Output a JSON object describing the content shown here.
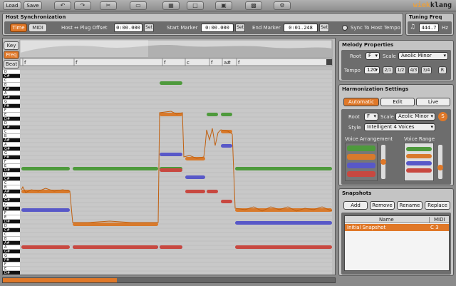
{
  "toolbar": {
    "load": "Load",
    "save": "Save",
    "icons": [
      "undo-icon",
      "redo-icon",
      "cut-icon",
      "copy-icon",
      "paste-icon",
      "delete-icon",
      "quantize-icon",
      "align-icon",
      "settings-icon"
    ]
  },
  "brand": {
    "part1": "wiek",
    "part2": "klang"
  },
  "host_sync": {
    "title": "Host Synchronization",
    "time": "Time",
    "midi": "MIDI",
    "offset_label": "Host ↔ Plug Offset",
    "offset_value": "0:00.000",
    "set": "Set",
    "start_label": "Start Marker",
    "start_value": "0:00.000",
    "end_label": "End Marker",
    "end_value": "0:01.248",
    "sync_label": "Sync To Host Tempo"
  },
  "tuning": {
    "title": "Tuning Freq",
    "value": "444.7",
    "unit": "Hz"
  },
  "editor": {
    "modes": [
      "Key",
      "Freq",
      "Beat"
    ],
    "active_mode": "Freq",
    "chord_markers": [
      "f",
      "f",
      "f",
      "c",
      "f",
      "a#",
      "f"
    ],
    "piano_keys": [
      "D",
      "C#",
      "C",
      "B",
      "A#",
      "A",
      "G#",
      "G",
      "F#",
      "F",
      "E",
      "D#",
      "D",
      "C#",
      "C",
      "B",
      "A#",
      "A",
      "G#",
      "G",
      "F#",
      "F",
      "E",
      "D#",
      "D",
      "C#",
      "C",
      "B",
      "A#",
      "A",
      "G#",
      "G",
      "F#",
      "F",
      "E",
      "D#",
      "D",
      "C#",
      "C",
      "B",
      "A#",
      "A",
      "G#",
      "G",
      "F#",
      "F",
      "E",
      "D#"
    ]
  },
  "melody": {
    "title": "Melody Properties",
    "root_label": "Root",
    "root": "F",
    "scale_label": "Scale",
    "scale": "Aeolic Minor",
    "tempo_label": "Tempo",
    "tempo": "120",
    "divisions": [
      "2/1",
      "1/2",
      "4/3",
      "3/4",
      "R"
    ]
  },
  "harmonization": {
    "title": "Harmonization Settings",
    "tabs": [
      "Automatic",
      "Edit",
      "Live"
    ],
    "active_tab": "Automatic",
    "root_label": "Root",
    "root": "F",
    "scale_label": "Scale",
    "scale": "Aeolic Minor",
    "s_badge": "S",
    "style_label": "Style",
    "style": "Intelligent 4 Voices",
    "voice_arrangement": "Voice Arrangement",
    "voice_range": "Voice Range",
    "voice_colors": [
      "#4e9a3c",
      "#d87a2c",
      "#5858c8",
      "#c84840"
    ]
  },
  "snapshots": {
    "title": "Snapshots",
    "buttons": [
      "Add",
      "Remove",
      "Rename",
      "Replace"
    ],
    "col_name": "Name",
    "col_midi": "MIDI",
    "rows": [
      {
        "name": "Initial Snapshot",
        "midi": "C 3"
      }
    ]
  },
  "colors": {
    "accent": "#e07828",
    "green": "#4e9a3c",
    "orange": "#d87a2c",
    "blue": "#5858c8",
    "red": "#c84840"
  }
}
